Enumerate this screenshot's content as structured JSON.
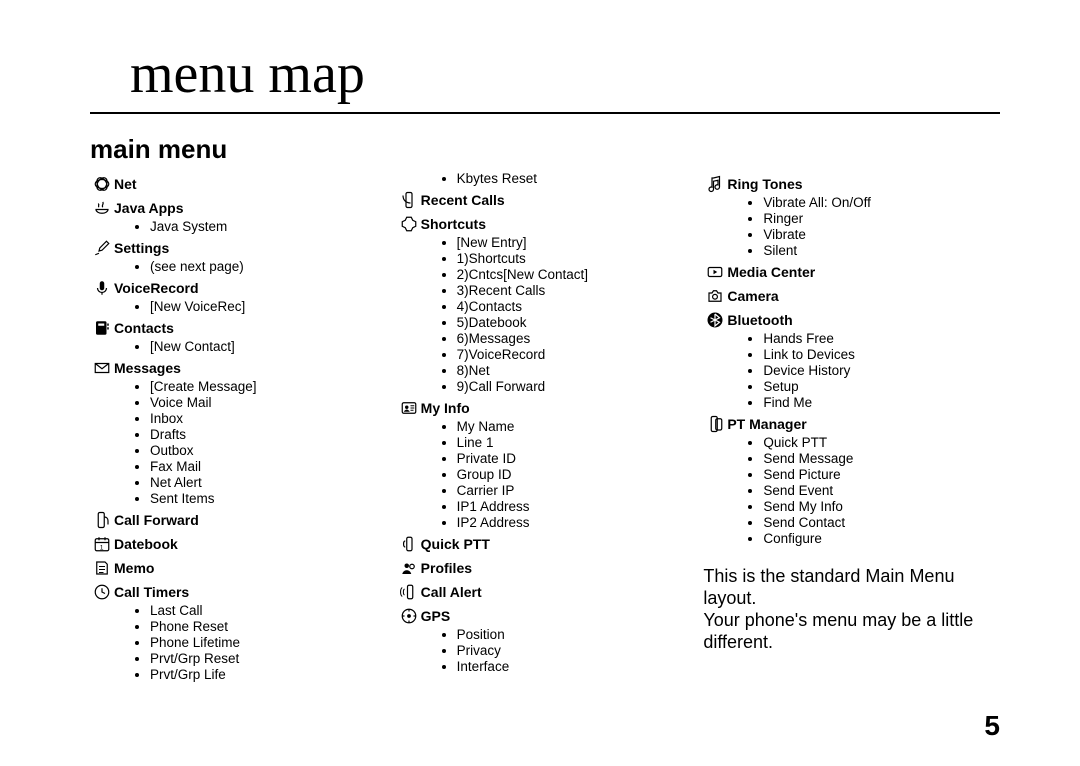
{
  "page_title": "menu map",
  "section_title": "main menu",
  "note_line1": "This is the standard Main Menu layout.",
  "note_line2": "Your phone's menu may be a little different.",
  "page_number": "5",
  "col1": {
    "net": "Net",
    "java_apps": "Java Apps",
    "java_apps_items": {
      "i0": "Java System"
    },
    "settings": "Settings",
    "settings_items": {
      "i0": "(see next page)"
    },
    "voicerecord": "VoiceRecord",
    "voicerecord_items": {
      "i0": "[New VoiceRec]"
    },
    "contacts": "Contacts",
    "contacts_items": {
      "i0": "[New Contact]"
    },
    "messages": "Messages",
    "messages_items": {
      "i0": "[Create Message]",
      "i1": "Voice Mail",
      "i2": "Inbox",
      "i3": "Drafts",
      "i4": "Outbox",
      "i5": "Fax Mail",
      "i6": "Net Alert",
      "i7": "Sent Items"
    },
    "call_forward": "Call Forward",
    "datebook": "Datebook",
    "memo": "Memo",
    "call_timers": "Call Timers",
    "call_timers_items": {
      "i0": "Last Call",
      "i1": "Phone Reset",
      "i2": "Phone Lifetime",
      "i3": "Prvt/Grp Reset",
      "i4": "Prvt/Grp Life"
    }
  },
  "col2": {
    "kbytes_items": {
      "i0": "Kbytes Reset"
    },
    "recent_calls": "Recent Calls",
    "shortcuts": "Shortcuts",
    "shortcuts_items": {
      "i0": "[New Entry]",
      "i1": "1)Shortcuts",
      "i2": "2)Cntcs[New Contact]",
      "i3": "3)Recent Calls",
      "i4": "4)Contacts",
      "i5": "5)Datebook",
      "i6": "6)Messages",
      "i7": "7)VoiceRecord",
      "i8": "8)Net",
      "i9": "9)Call Forward"
    },
    "my_info": "My Info",
    "my_info_items": {
      "i0": "My Name",
      "i1": "Line 1",
      "i2": "Private ID",
      "i3": "Group ID",
      "i4": "Carrier IP",
      "i5": "IP1 Address",
      "i6": "IP2 Address"
    },
    "quick_ptt": "Quick PTT",
    "profiles": "Profiles",
    "call_alert": "Call Alert",
    "gps": "GPS",
    "gps_items": {
      "i0": "Position",
      "i1": "Privacy",
      "i2": "Interface"
    }
  },
  "col3": {
    "ring_tones": "Ring Tones",
    "ring_tones_items": {
      "i0": "Vibrate All: On/Off",
      "i1": "Ringer",
      "i2": "Vibrate",
      "i3": "Silent"
    },
    "media_center": "Media Center",
    "camera": "Camera",
    "bluetooth": "Bluetooth",
    "bluetooth_items": {
      "i0": "Hands Free",
      "i1": "Link to Devices",
      "i2": "Device History",
      "i3": "Setup",
      "i4": "Find Me"
    },
    "pt_manager": "PT Manager",
    "pt_manager_items": {
      "i0": "Quick PTT",
      "i1": "Send Message",
      "i2": "Send Picture",
      "i3": "Send Event",
      "i4": "Send My Info",
      "i5": "Send Contact",
      "i6": "Configure"
    }
  }
}
